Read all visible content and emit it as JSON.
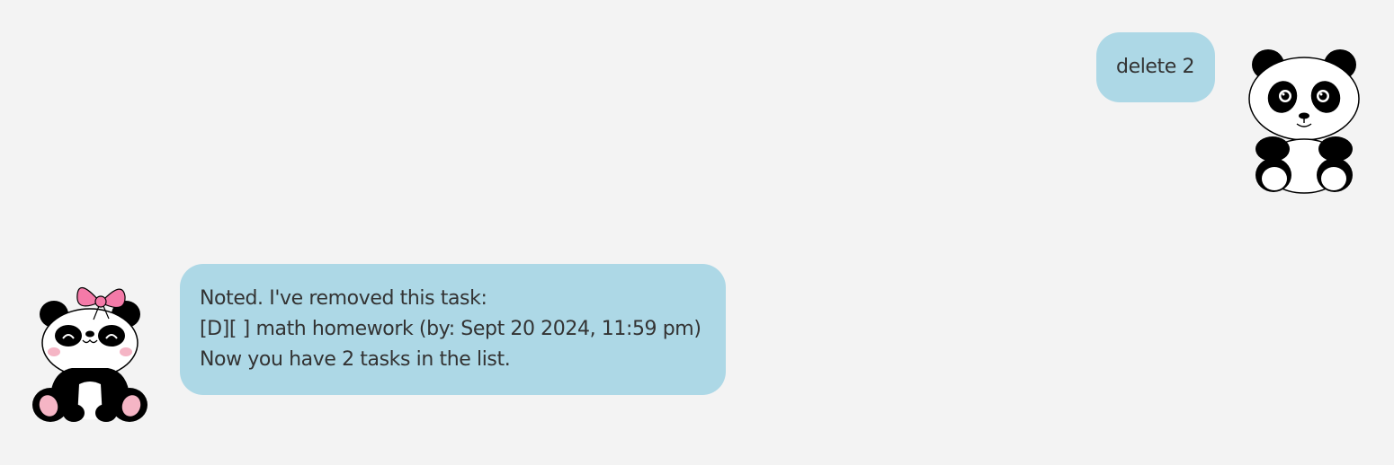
{
  "messages": {
    "user": {
      "text": "delete 2",
      "avatar": "panda-avatar"
    },
    "bot": {
      "lines": [
        "Noted. I've removed this task:",
        "[D][ ] math homework (by: Sept 20 2024, 11:59 pm)",
        "Now you have 2 tasks in the list."
      ],
      "avatar": "panda-with-bow-avatar"
    }
  },
  "colors": {
    "background": "#f3f3f3",
    "bubble": "#add8e6",
    "text": "#333333",
    "bow": "#f47aa8",
    "cheek": "#f5b5c5"
  }
}
